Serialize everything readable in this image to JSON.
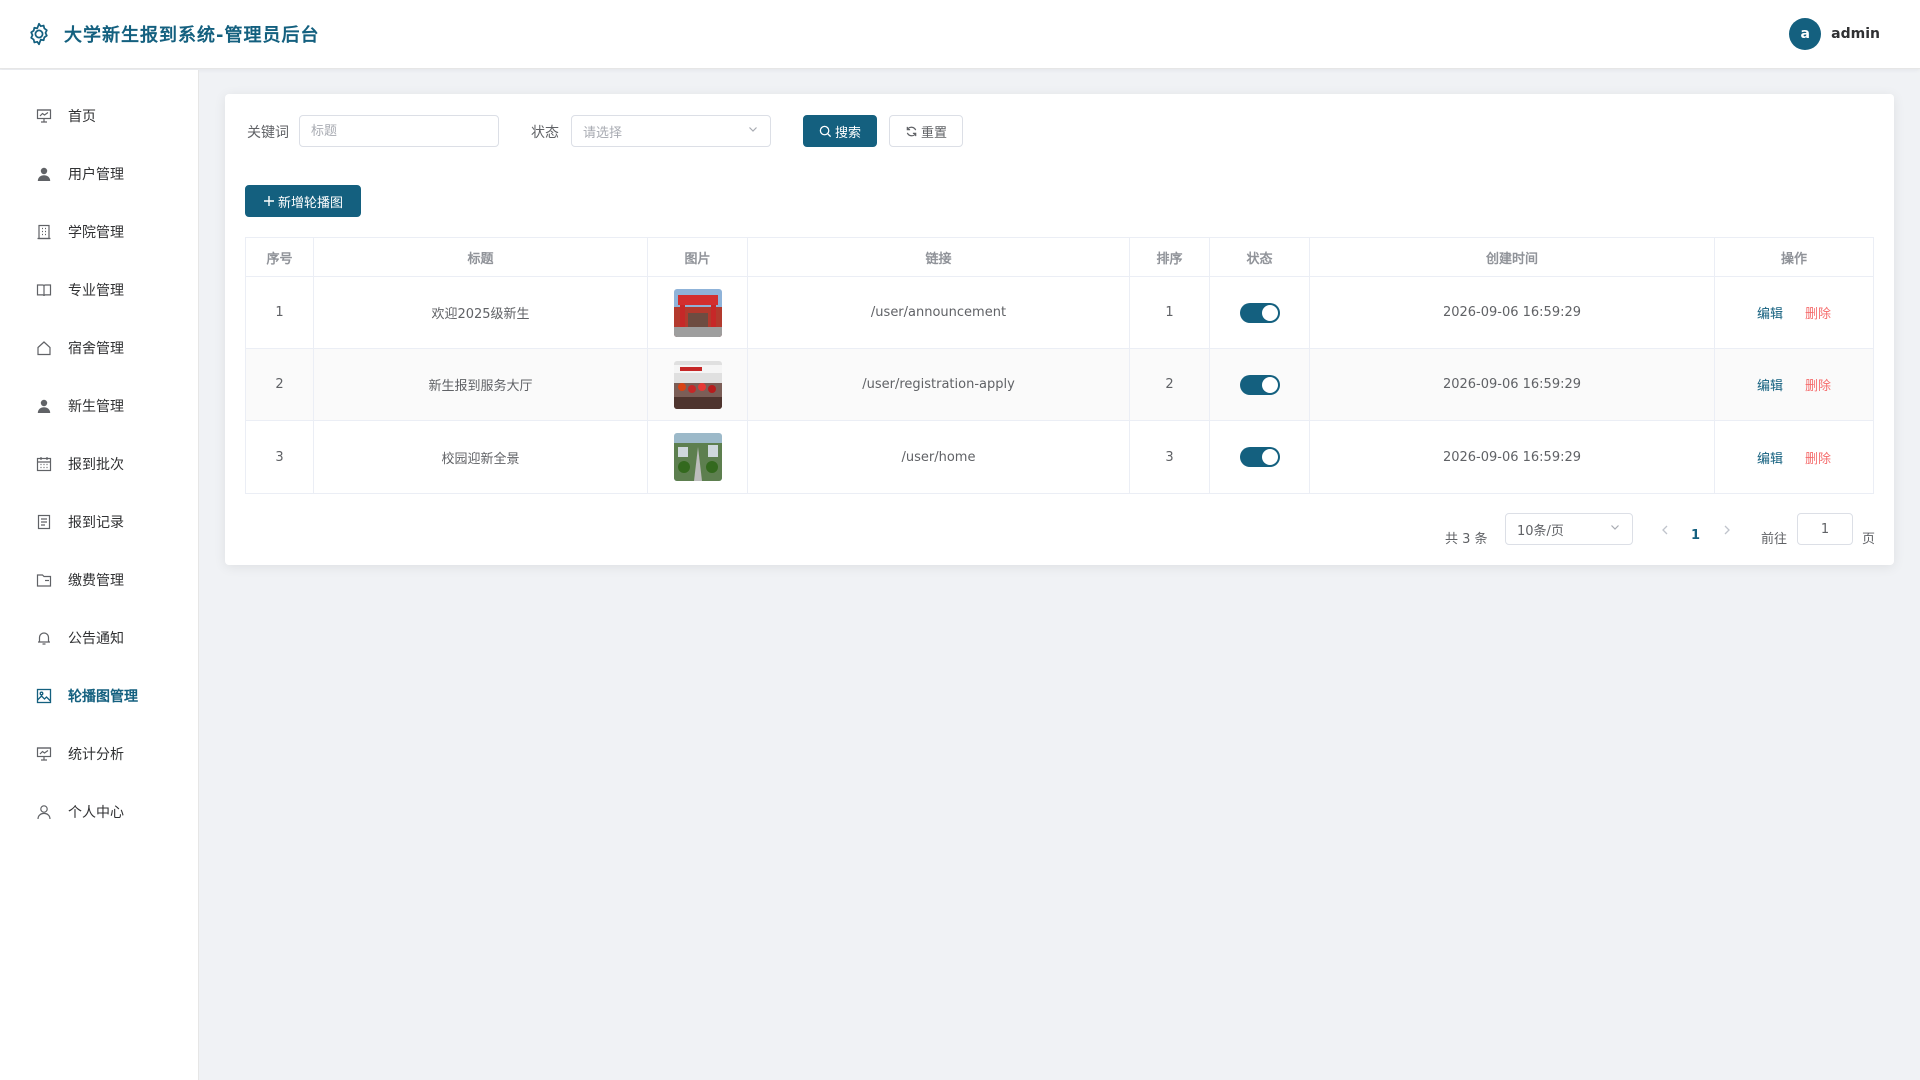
{
  "header": {
    "title": "大学新生报到系统-管理员后台",
    "avatar_letter": "a",
    "username": "admin"
  },
  "sidebar": {
    "items": [
      {
        "label": "首页",
        "icon": "presentation-icon"
      },
      {
        "label": "用户管理",
        "icon": "user-filled-icon"
      },
      {
        "label": "学院管理",
        "icon": "office-building-icon"
      },
      {
        "label": "专业管理",
        "icon": "book-icon"
      },
      {
        "label": "宿舍管理",
        "icon": "house-icon"
      },
      {
        "label": "新生管理",
        "icon": "user-filled-icon"
      },
      {
        "label": "报到批次",
        "icon": "calendar-icon"
      },
      {
        "label": "报到记录",
        "icon": "document-icon"
      },
      {
        "label": "缴费管理",
        "icon": "folder-icon"
      },
      {
        "label": "公告通知",
        "icon": "bell-icon"
      },
      {
        "label": "轮播图管理",
        "icon": "picture-icon",
        "active": true
      },
      {
        "label": "统计分析",
        "icon": "presentation-icon"
      },
      {
        "label": "个人中心",
        "icon": "user-icon"
      }
    ]
  },
  "search": {
    "keyword_label": "关键词",
    "keyword_placeholder": "标题",
    "keyword_value": "",
    "status_label": "状态",
    "status_placeholder": "请选择",
    "search_button": "搜索",
    "reset_button": "重置"
  },
  "toolbar": {
    "add_button": "新增轮播图"
  },
  "table": {
    "columns": [
      "序号",
      "标题",
      "图片",
      "链接",
      "排序",
      "状态",
      "创建时间",
      "操作"
    ],
    "rows": [
      {
        "index": "1",
        "title": "欢迎2025级新生",
        "link": "/user/announcement",
        "sort": "1",
        "status_on": true,
        "created": "2026-09-06 16:59:29"
      },
      {
        "index": "2",
        "title": "新生报到服务大厅",
        "link": "/user/registration-apply",
        "sort": "2",
        "status_on": true,
        "created": "2026-09-06 16:59:29"
      },
      {
        "index": "3",
        "title": "校园迎新全景",
        "link": "/user/home",
        "sort": "3",
        "status_on": true,
        "created": "2026-09-06 16:59:29"
      }
    ],
    "edit_label": "编辑",
    "delete_label": "删除"
  },
  "pagination": {
    "total_text": "共 3 条",
    "page_size": "10条/页",
    "current_page": "1",
    "goto_label": "前往",
    "goto_value": "1",
    "page_unit": "页"
  },
  "colors": {
    "primary": "#14607f",
    "danger": "#f56c6c"
  }
}
